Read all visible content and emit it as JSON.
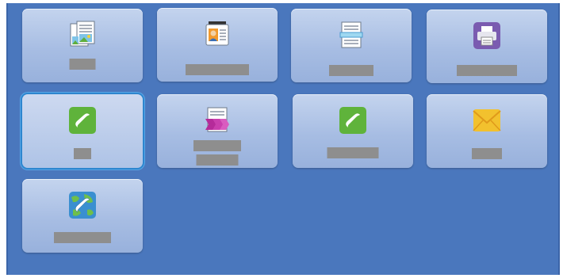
{
  "tiles": [
    {
      "icon": "copy-icon",
      "label": ""
    },
    {
      "icon": "id-card-copy-icon",
      "label": ""
    },
    {
      "icon": "scan-icon",
      "label": ""
    },
    {
      "icon": "print-icon",
      "label": ""
    },
    {
      "icon": "fax-icon",
      "label": "",
      "selected": true
    },
    {
      "icon": "workflow-scanning-icon",
      "label_line1": "",
      "label_line2": ""
    },
    {
      "icon": "server-fax-icon",
      "label": ""
    },
    {
      "icon": "email-icon",
      "label": ""
    },
    {
      "icon": "internet-fax-icon",
      "label": ""
    }
  ],
  "colors": {
    "panel_background": "#4a77bd",
    "tile_background": "#a7bde3",
    "selected_outline": "#2d86cf",
    "fax_green": "#5fb33b",
    "print_purple": "#7a5bb0",
    "email_yellow": "#f2c12e",
    "workflow_magenta": "#b52b9a"
  }
}
